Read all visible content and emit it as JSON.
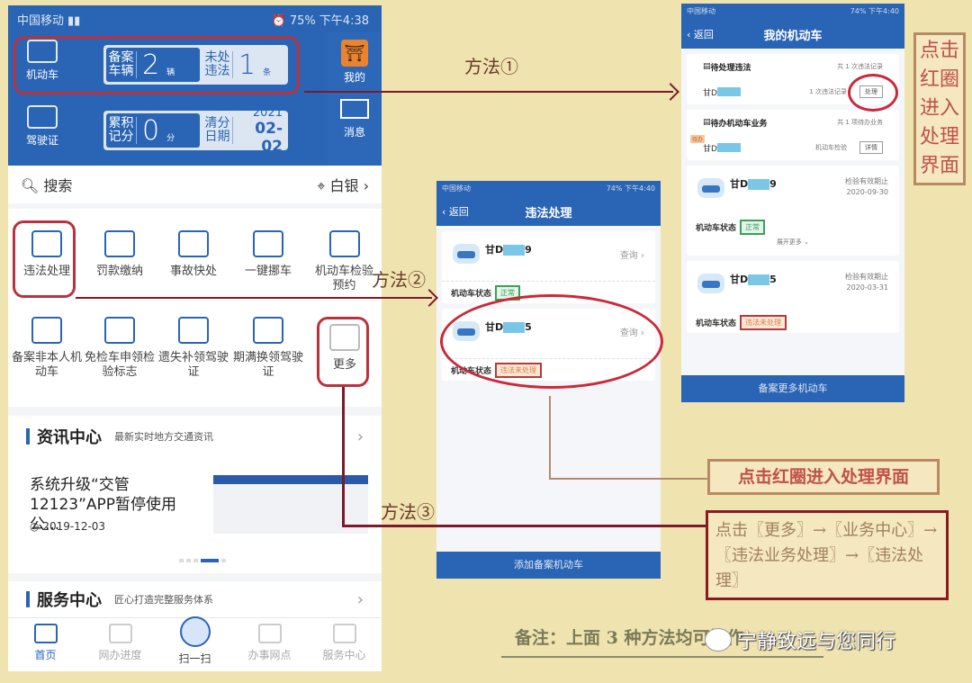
{
  "phone_home": {
    "status": {
      "carrier": "中国移动",
      "battery": "75%",
      "time": "下午4:38"
    },
    "vehicle": {
      "label": "机动车",
      "registered_label": "备案车辆",
      "registered_count": "2",
      "registered_unit": "辆",
      "violation_label": "未处违法",
      "violation_count": "1",
      "violation_unit": "条"
    },
    "license": {
      "label": "驾驶证",
      "points_label": "累积记分",
      "points": "0",
      "points_unit": "分",
      "clear_label": "清分日期",
      "clear_year": "2021",
      "clear_date": "02-02"
    },
    "right": {
      "mine": "我的",
      "messages": "消息"
    },
    "search": {
      "placeholder": "搜索",
      "location": "白银"
    },
    "services": [
      {
        "label": "违法处理",
        "icon": "car-violation-icon"
      },
      {
        "label": "罚款缴纳",
        "icon": "fine-payment-icon"
      },
      {
        "label": "事故快处",
        "icon": "accident-icon"
      },
      {
        "label": "一键挪车",
        "icon": "move-car-icon"
      },
      {
        "label": "机动车检验预约",
        "icon": "inspection-icon"
      },
      {
        "label": "备案非本人机动车",
        "icon": "register-car-icon"
      },
      {
        "label": "免检车申领检验标志",
        "icon": "exempt-icon"
      },
      {
        "label": "遗失补领驾驶证",
        "icon": "reissue-license-icon"
      },
      {
        "label": "期满换领驾驶证",
        "icon": "renew-license-icon"
      },
      {
        "label": "更多",
        "icon": "more-grid-icon"
      }
    ],
    "news": {
      "title": "资讯中心",
      "subtitle": "最新实时地方交通资讯",
      "headline": "系统升级“交管12123”APP暂停使用公...",
      "date": "2019-12-03"
    },
    "service_center": {
      "title": "服务中心",
      "subtitle": "匠心打造完整服务体系"
    },
    "tabs": [
      "首页",
      "网办进度",
      "扫一扫",
      "办事网点",
      "服务中心"
    ]
  },
  "phone_violation": {
    "status": {
      "carrier": "中国移动",
      "battery": "74%",
      "time": "下午4:40"
    },
    "back": "返回",
    "title": "违法处理",
    "vehicles": [
      {
        "plate_prefix": "甘D",
        "plate_suffix": "9",
        "query": "查询",
        "status_label": "机动车状态",
        "status": "正常"
      },
      {
        "plate_prefix": "甘D",
        "plate_suffix": "5",
        "query": "查询",
        "status_label": "机动车状态",
        "status": "违法未处理"
      }
    ],
    "add_button": "添加备案机动车"
  },
  "phone_mycar": {
    "status": {
      "carrier": "中国移动",
      "battery": "74%",
      "time": "下午4:40"
    },
    "back": "返回",
    "title": "我的机动车",
    "pending_violation": {
      "title": "待处理违法",
      "count": "共 1 次违法记录",
      "plate": "甘D",
      "records": "1 次违法记录",
      "action": "处理"
    },
    "pending_business": {
      "title": "待办机动车业务",
      "count": "共 1 项待办业务",
      "tag": "待办",
      "plate": "甘D",
      "item": "机动车检验",
      "action": "详情"
    },
    "vehicles": [
      {
        "plate_prefix": "甘D",
        "plate_suffix": "9",
        "expiry_label": "检验有效期止",
        "expiry": "2020-09-30",
        "status_label": "机动车状态",
        "status": "正常",
        "expand": "展开更多"
      },
      {
        "plate_prefix": "甘D",
        "plate_suffix": "5",
        "expiry_label": "检验有效期止",
        "expiry": "2020-03-31",
        "status_label": "机动车状态",
        "status": "违法未处理"
      }
    ],
    "add_button": "备案更多机动车"
  },
  "annotations": {
    "method1": "方法①",
    "method2": "方法②",
    "method3": "方法③",
    "note_vertical": "点击红圈进入处理界面",
    "note_horizontal": "点击红圈进入处理界面",
    "note_method3": "点击〖更多〗→〖业务中心〗→〖违法业务处理〗→〖违法处理〗",
    "remark": "备注：上面 3 种方法均可操作",
    "watermark": "宁静致远与您同行"
  }
}
